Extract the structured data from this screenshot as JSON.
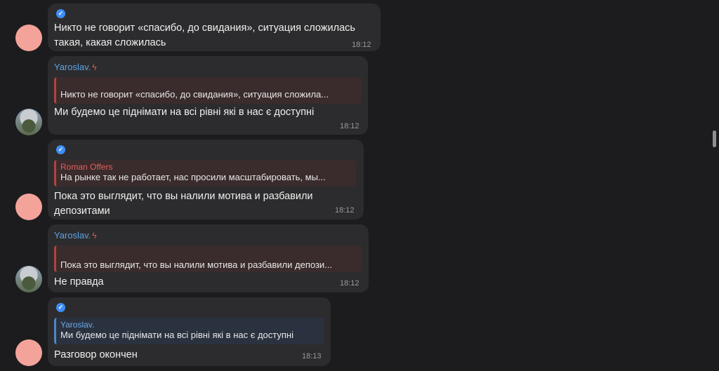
{
  "messages": [
    {
      "text": "Никто не говорит «спасибо, до свидания», ситуация сложилась такая, какая сложилась",
      "time": "18:12"
    },
    {
      "sender": "Yaroslav.",
      "quote_text": "Никто не говорит «спасибо, до свидания», ситуация сложила...",
      "text": "Ми будемо це піднімати на всі рівні які в нас є доступні",
      "time": "18:12"
    },
    {
      "quote_name": "Roman Offers",
      "quote_text": "На рынке так не работает, нас просили масштабировать, мы...",
      "text": "Пока это выглядит, что вы налили мотива и разбавили депозитами",
      "time": "18:12"
    },
    {
      "sender": "Yaroslav.",
      "quote_text": "Пока это выглядит, что вы налили мотива и разбавили депози...",
      "text": "Не правда",
      "time": "18:12"
    },
    {
      "quote_name": "Yaroslav.",
      "quote_text": "Ми будемо це піднімати на всі рівні які в нас є доступні",
      "text": "Разговор окончен",
      "time": "18:13"
    }
  ],
  "icons": {
    "verified": "verified-badge-icon",
    "bolt": "lightning-bolt-icon"
  },
  "colors": {
    "background": "#1c1c1e",
    "bubble": "#2c2c2e",
    "sender_blue": "#5ea3e6",
    "quote_red": "#e0605a",
    "verified_blue": "#3e8ef7"
  }
}
